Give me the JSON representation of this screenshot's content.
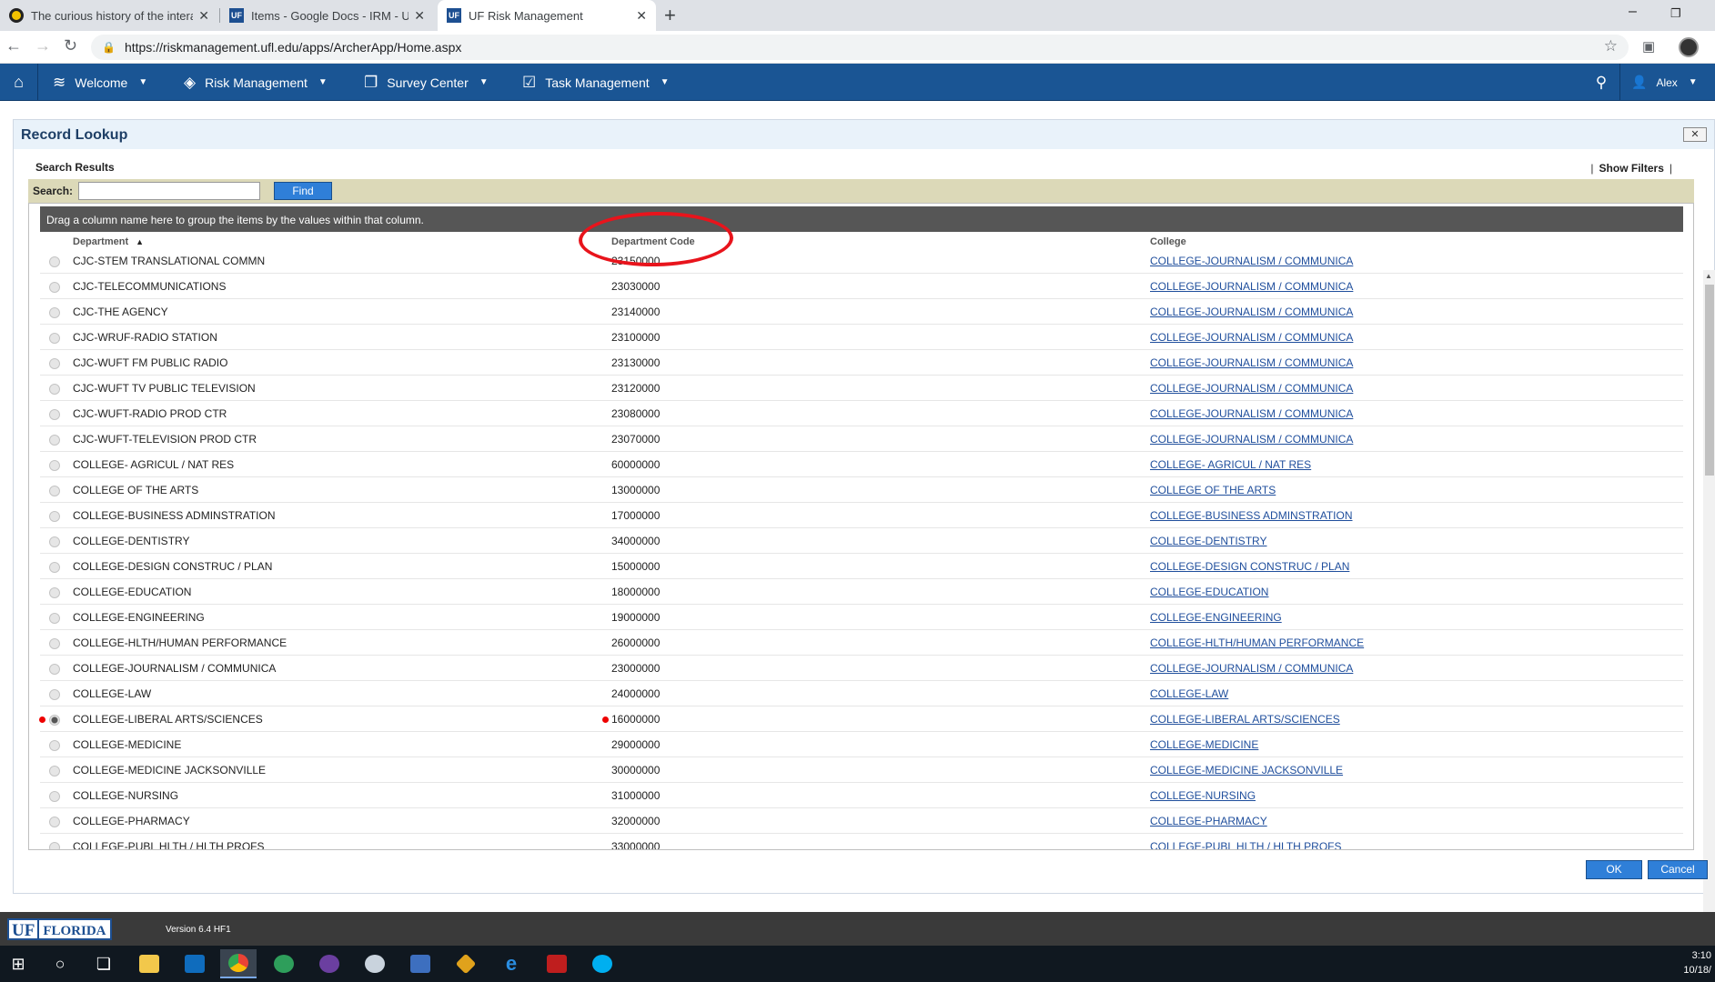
{
  "browser": {
    "tabs": [
      {
        "title": "The curious history of the interac",
        "favicon": "ring-icon",
        "active": false
      },
      {
        "title": "Items - Google Docs - IRM - Univ",
        "favicon": "uf-icon",
        "active": false
      },
      {
        "title": "UF Risk Management",
        "favicon": "uf-icon",
        "active": true
      }
    ],
    "url": "https://riskmanagement.ufl.edu/apps/ArcherApp/Home.aspx",
    "close_glyph": "✕",
    "newtab_glyph": "+"
  },
  "appnav": {
    "items": [
      {
        "label": "Welcome",
        "icon": "layers-icon"
      },
      {
        "label": "Risk Management",
        "icon": "diamond-icon"
      },
      {
        "label": "Survey Center",
        "icon": "documents-icon"
      },
      {
        "label": "Task Management",
        "icon": "checklist-icon"
      }
    ],
    "user": "Alex",
    "bg_color": "#1a5594"
  },
  "dialog": {
    "title": "Record Lookup",
    "search_results_label": "Search Results",
    "show_filters_label": "Show Filters",
    "search_label": "Search:",
    "search_value": "",
    "find_label": "Find",
    "group_hint": "Drag a column name here to group the items by the values within that column.",
    "columns": [
      "Department",
      "Department Code",
      "College"
    ],
    "rows": [
      {
        "dept": "CJC-STEM TRANSLATIONAL COMMN",
        "code": "23150000",
        "college": "COLLEGE-JOURNALISM / COMMUNICA"
      },
      {
        "dept": "CJC-TELECOMMUNICATIONS",
        "code": "23030000",
        "college": "COLLEGE-JOURNALISM / COMMUNICA"
      },
      {
        "dept": "CJC-THE AGENCY",
        "code": "23140000",
        "college": "COLLEGE-JOURNALISM / COMMUNICA"
      },
      {
        "dept": "CJC-WRUF-RADIO STATION",
        "code": "23100000",
        "college": "COLLEGE-JOURNALISM / COMMUNICA"
      },
      {
        "dept": "CJC-WUFT FM PUBLIC RADIO",
        "code": "23130000",
        "college": "COLLEGE-JOURNALISM / COMMUNICA"
      },
      {
        "dept": "CJC-WUFT TV PUBLIC TELEVISION",
        "code": "23120000",
        "college": "COLLEGE-JOURNALISM / COMMUNICA"
      },
      {
        "dept": "CJC-WUFT-RADIO PROD CTR",
        "code": "23080000",
        "college": "COLLEGE-JOURNALISM / COMMUNICA"
      },
      {
        "dept": "CJC-WUFT-TELEVISION PROD CTR",
        "code": "23070000",
        "college": "COLLEGE-JOURNALISM / COMMUNICA"
      },
      {
        "dept": "COLLEGE- AGRICUL / NAT RES",
        "code": "60000000",
        "college": "COLLEGE- AGRICUL / NAT RES"
      },
      {
        "dept": "COLLEGE OF THE ARTS",
        "code": "13000000",
        "college": "COLLEGE OF THE ARTS"
      },
      {
        "dept": "COLLEGE-BUSINESS ADMINSTRATION",
        "code": "17000000",
        "college": "COLLEGE-BUSINESS ADMINSTRATION"
      },
      {
        "dept": "COLLEGE-DENTISTRY",
        "code": "34000000",
        "college": "COLLEGE-DENTISTRY"
      },
      {
        "dept": "COLLEGE-DESIGN CONSTRUC / PLAN",
        "code": "15000000",
        "college": "COLLEGE-DESIGN CONSTRUC / PLAN"
      },
      {
        "dept": "COLLEGE-EDUCATION",
        "code": "18000000",
        "college": "COLLEGE-EDUCATION"
      },
      {
        "dept": "COLLEGE-ENGINEERING",
        "code": "19000000",
        "college": "COLLEGE-ENGINEERING"
      },
      {
        "dept": "COLLEGE-HLTH/HUMAN PERFORMANCE",
        "code": "26000000",
        "college": "COLLEGE-HLTH/HUMAN PERFORMANCE"
      },
      {
        "dept": "COLLEGE-JOURNALISM / COMMUNICA",
        "code": "23000000",
        "college": "COLLEGE-JOURNALISM / COMMUNICA"
      },
      {
        "dept": "COLLEGE-LAW",
        "code": "24000000",
        "college": "COLLEGE-LAW"
      },
      {
        "dept": "COLLEGE-LIBERAL ARTS/SCIENCES",
        "code": "16000000",
        "college": "COLLEGE-LIBERAL ARTS/SCIENCES",
        "selected": true,
        "marked": true
      },
      {
        "dept": "COLLEGE-MEDICINE",
        "code": "29000000",
        "college": "COLLEGE-MEDICINE"
      },
      {
        "dept": "COLLEGE-MEDICINE JACKSONVILLE",
        "code": "30000000",
        "college": "COLLEGE-MEDICINE JACKSONVILLE"
      },
      {
        "dept": "COLLEGE-NURSING",
        "code": "31000000",
        "college": "COLLEGE-NURSING"
      },
      {
        "dept": "COLLEGE-PHARMACY",
        "code": "32000000",
        "college": "COLLEGE-PHARMACY"
      },
      {
        "dept": "COLLEGE-PUBL HLTH / HLTH PROFS",
        "code": "33000000",
        "college": "COLLEGE-PUBL HLTH / HLTH PROFS"
      }
    ],
    "ok_label": "OK",
    "cancel_label": "Cancel",
    "accent_color": "#2f7fd8",
    "annotation_color": "#e8141c"
  },
  "footer": {
    "logo_uf": "UF",
    "logo_florida": "FLORIDA",
    "version": "Version 6.4 HF1"
  },
  "taskbar": {
    "icons": [
      "windows-icon",
      "cortana-icon",
      "task-view-icon",
      "file-explorer-icon",
      "outlook-icon",
      "chrome-icon",
      "green-app-icon",
      "purple-app-icon",
      "paint-app-icon",
      "network-app-icon",
      "git-app-icon",
      "ie-icon",
      "filezilla-icon",
      "skype-icon"
    ],
    "time": "3:10",
    "date": "10/18/"
  }
}
